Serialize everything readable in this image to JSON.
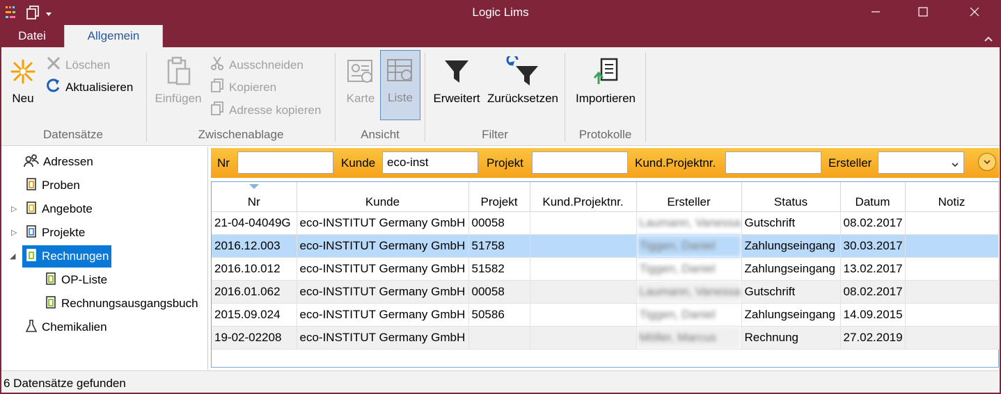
{
  "window": {
    "title": "Logic Lims"
  },
  "ribbon_tabs": [
    "Datei",
    "Allgemein"
  ],
  "ribbon": {
    "datensaetze": {
      "label": "Datensätze",
      "neu": "Neu",
      "loeschen": "Löschen",
      "aktualisieren": "Aktualisieren"
    },
    "zwischenablage": {
      "label": "Zwischenablage",
      "einfuegen": "Einfügen",
      "ausschneiden": "Ausschneiden",
      "kopieren": "Kopieren",
      "adresse_kopieren": "Adresse kopieren"
    },
    "ansicht": {
      "label": "Ansicht",
      "karte": "Karte",
      "liste": "Liste"
    },
    "filter": {
      "label": "Filter",
      "erweitert": "Erweitert",
      "zuruecksetzen": "Zurücksetzen"
    },
    "protokolle": {
      "label": "Protokolle",
      "importieren": "Importieren"
    }
  },
  "nav": {
    "items": [
      {
        "label": "Adressen",
        "icon": "people-icon"
      },
      {
        "label": "Proben",
        "icon": "document-icon"
      },
      {
        "label": "Angebote",
        "icon": "document-icon"
      },
      {
        "label": "Projekte",
        "icon": "document-icon"
      },
      {
        "label": "Rechnungen",
        "icon": "document-icon",
        "selected": true
      },
      {
        "label": "OP-Liste",
        "icon": "document-icon"
      },
      {
        "label": "Rechnungsausgangsbuch",
        "icon": "document-icon"
      },
      {
        "label": "Chemikalien",
        "icon": "flask-icon"
      }
    ]
  },
  "filters": {
    "nr_label": "Nr",
    "nr_value": "",
    "kunde_label": "Kunde",
    "kunde_value": "eco-inst",
    "projekt_label": "Projekt",
    "projekt_value": "",
    "kundprojekt_label": "Kund.Projektnr.",
    "kundprojekt_value": "",
    "ersteller_label": "Ersteller",
    "ersteller_value": ""
  },
  "table": {
    "columns": [
      "Nr",
      "Kunde",
      "Projekt",
      "Kund.Projektnr.",
      "Ersteller",
      "Status",
      "Datum",
      "Notiz"
    ],
    "rows": [
      [
        "21-04-04049G",
        "eco-INSTITUT Germany GmbH",
        "00058",
        "",
        "Laumann, Vanessa",
        "Gutschrift",
        "08.02.2017",
        ""
      ],
      [
        "2016.12.003",
        "eco-INSTITUT Germany GmbH",
        "51758",
        "",
        "Tiggen, Daniel",
        "Zahlungseingang",
        "30.03.2017",
        ""
      ],
      [
        "2016.10.012",
        "eco-INSTITUT Germany GmbH",
        "51582",
        "",
        "Tiggen, Daniel",
        "Zahlungseingang",
        "13.02.2017",
        ""
      ],
      [
        "2016.01.062",
        "eco-INSTITUT Germany GmbH",
        "00058",
        "",
        "Laumann, Vanessa",
        "Gutschrift",
        "08.02.2017",
        ""
      ],
      [
        "2015.09.024",
        "eco-INSTITUT Germany GmbH",
        "50586",
        "",
        "Tiggen, Daniel",
        "Zahlungseingang",
        "14.09.2015",
        ""
      ],
      [
        "19-02-02208",
        "eco-INSTITUT Germany GmbH",
        "",
        "",
        "Möller, Marcus",
        "Rechnung",
        "27.02.2019",
        ""
      ]
    ]
  },
  "status": {
    "text": "6 Datensätze gefunden"
  },
  "colors": {
    "titlebar": "#80243a",
    "filterbar": "#f6a21b",
    "selection": "#b9dafa",
    "nav_selection": "#0a78d7"
  }
}
